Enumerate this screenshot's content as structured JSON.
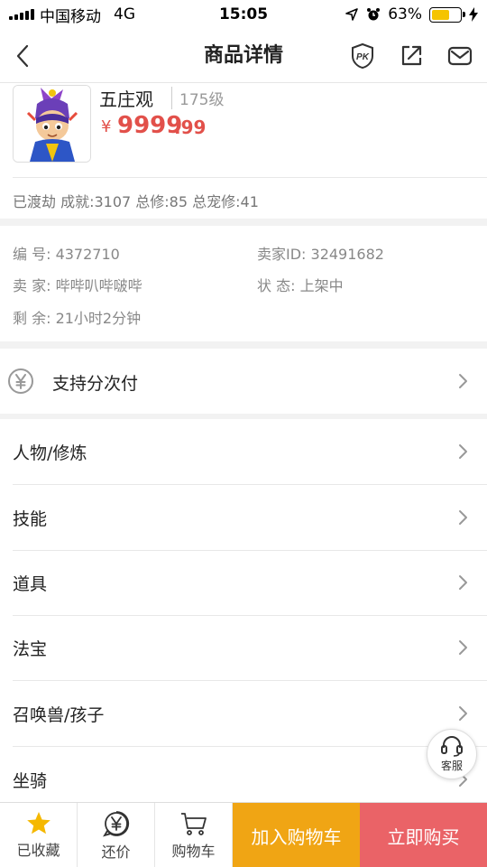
{
  "status_bar": {
    "carrier": "中国移动",
    "network": "4G",
    "time": "15:05",
    "battery_percent": "63%",
    "battery_level": 0.63
  },
  "nav": {
    "title": "商品详情",
    "icons": [
      "back-arrow-icon",
      "pk-badge-icon",
      "share-icon",
      "mail-icon"
    ]
  },
  "product": {
    "name": "五庄观",
    "level": "175级",
    "price_symbol": "¥",
    "price_int": "9999",
    "price_dec": ".99",
    "stats": "已渡劫 成就:3107 总修:85 总宠修:41"
  },
  "info": {
    "id": "编  号: 4372710",
    "seller_id": "卖家ID: 32491682",
    "seller": "卖  家: 哔哔叭哔啵哔",
    "status": "状  态: 上架中",
    "remaining": "剩  余: 21小时2分钟"
  },
  "installment": {
    "label": "支持分次付",
    "icon": "yen-circle-icon"
  },
  "menu": [
    {
      "label": "人物/修炼"
    },
    {
      "label": "技能"
    },
    {
      "label": "道具"
    },
    {
      "label": "法宝"
    },
    {
      "label": "召唤兽/孩子"
    },
    {
      "label": "坐骑"
    }
  ],
  "service": {
    "label": "客服"
  },
  "bottom_bar": {
    "favorite": "已收藏",
    "bargain": "还价",
    "cart": "购物车",
    "add_to_cart": "加入购物车",
    "buy_now": "立即购买"
  },
  "colors": {
    "price": "#e2504a",
    "add_to_cart_bg": "#f0a514",
    "buy_now_bg": "#ea6367",
    "battery_fill": "#f5c400",
    "favorite_star": "#f5b800"
  }
}
